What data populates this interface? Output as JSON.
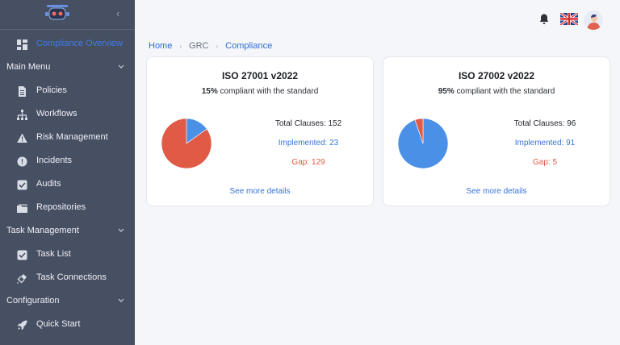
{
  "sidebar": {
    "overview": "Compliance Overview",
    "sections": [
      {
        "label": "Main Menu",
        "items": [
          "Policies",
          "Workflows",
          "Risk Management",
          "Incidents",
          "Audits",
          "Repositories"
        ]
      },
      {
        "label": "Task Management",
        "items": [
          "Task List",
          "Task Connections"
        ]
      },
      {
        "label": "Configuration",
        "items": [
          "Quick Start"
        ]
      }
    ]
  },
  "breadcrumb": [
    "Home",
    "GRC",
    "Compliance"
  ],
  "colors": {
    "accent": "#3d7be6",
    "implemented": "#4a90e6",
    "gap": "#e05a45",
    "sidebar": "#474f63"
  },
  "cards": [
    {
      "title": "ISO 27001 v2022",
      "percent": "15%",
      "subtitle": "compliant with the standard",
      "total": "Total Clauses: 152",
      "implemented": "Implemented: 23",
      "gap": "Gap: 129",
      "link": "See more details",
      "chart_data": {
        "type": "pie",
        "categories": [
          "Implemented",
          "Gap"
        ],
        "values": [
          23,
          129
        ]
      }
    },
    {
      "title": "ISO 27002 v2022",
      "percent": "95%",
      "subtitle": "compliant with the standard",
      "total": "Total Clauses: 96",
      "implemented": "Implemented: 91",
      "gap": "Gap: 5",
      "link": "See more details",
      "chart_data": {
        "type": "pie",
        "categories": [
          "Implemented",
          "Gap"
        ],
        "values": [
          91,
          5
        ]
      }
    }
  ]
}
